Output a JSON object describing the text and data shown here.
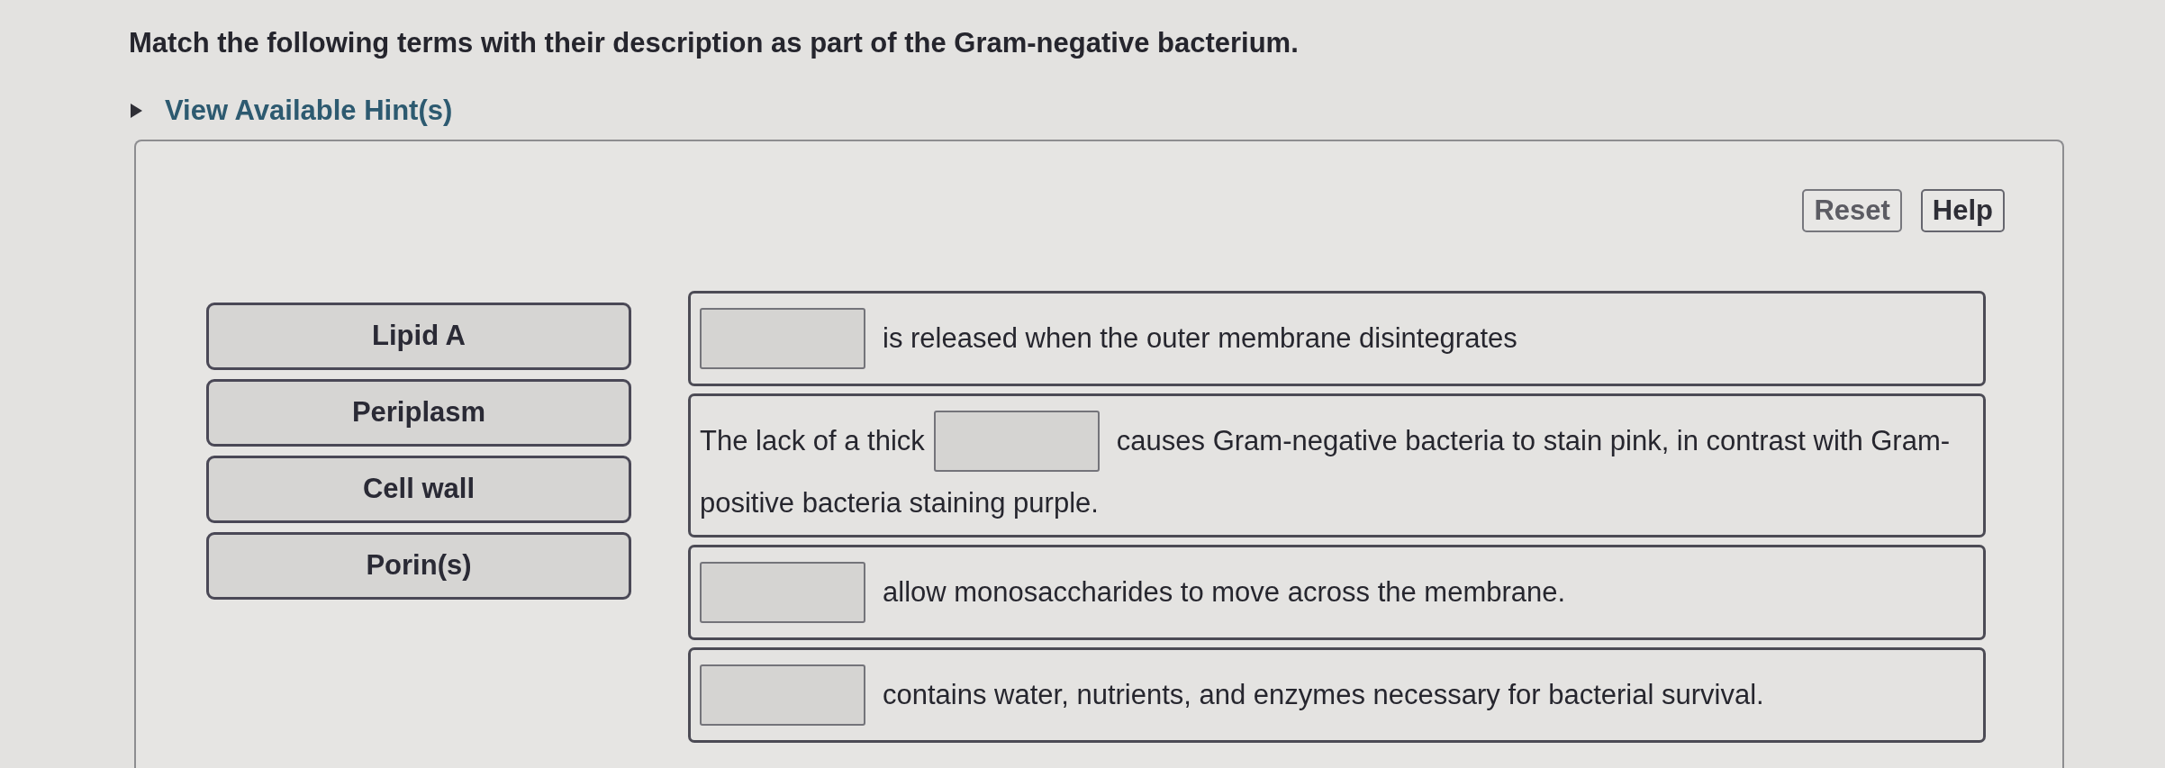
{
  "instruction": "Match the following terms with their description as part of the Gram-negative bacterium.",
  "hint_toggle": {
    "label": "View Available Hint(s)",
    "expanded": false
  },
  "toolbar": {
    "buttons": [
      {
        "label": "Reset",
        "disabled": true
      },
      {
        "label": "Help",
        "disabled": false
      }
    ]
  },
  "terms": [
    "Lipid A",
    "Periplasm",
    "Cell wall",
    "Porin(s)"
  ],
  "statements": [
    {
      "lines": [
        [
          {
            "kind": "blank"
          },
          {
            "kind": "text",
            "text": "is released when the outer membrane disintegrates"
          }
        ]
      ]
    },
    {
      "lines": [
        [
          {
            "kind": "text",
            "text": "The lack of a thick"
          },
          {
            "kind": "blank"
          },
          {
            "kind": "text",
            "text": "causes Gram-negative bacteria to stain pink, in contrast with Gram-"
          }
        ],
        [
          {
            "kind": "text",
            "text": "positive bacteria staining purple."
          }
        ]
      ]
    },
    {
      "lines": [
        [
          {
            "kind": "blank"
          },
          {
            "kind": "text",
            "text": "allow monosaccharides to move across the membrane."
          }
        ]
      ]
    },
    {
      "lines": [
        [
          {
            "kind": "blank"
          },
          {
            "kind": "text",
            "text": "contains water, nutrients, and enzymes necessary for bacterial survival."
          }
        ]
      ]
    }
  ]
}
